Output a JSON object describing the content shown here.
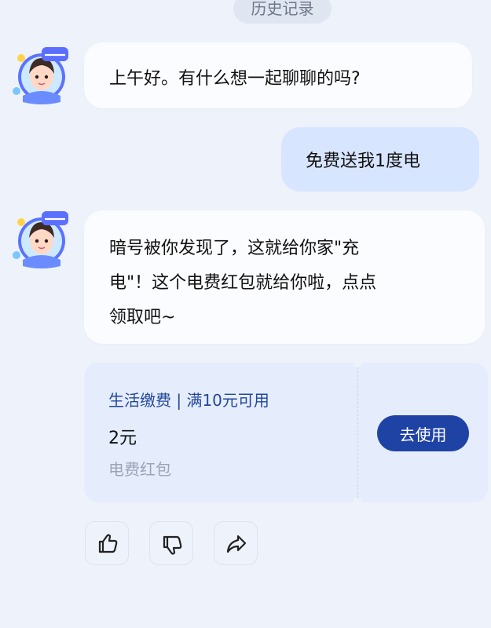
{
  "header": {
    "history_label": "历史记录"
  },
  "assistant": {
    "avatar_icon": "assistant-avatar-icon",
    "greeting": "上午好。有什么想一起聊聊的吗?",
    "reply_lines": [
      "暗号被你发现了，这就给你家\"充",
      "电\"！这个电费红包就给你啦，点点",
      "领取吧~"
    ]
  },
  "user": {
    "message": "免费送我1度电"
  },
  "coupon": {
    "title": "生活缴费 | 满10元可用",
    "amount": "2元",
    "name": "电费红包",
    "button_label": "去使用"
  },
  "actions": [
    {
      "icon": "thumbs-up-icon"
    },
    {
      "icon": "thumbs-down-icon"
    },
    {
      "icon": "share-icon"
    }
  ],
  "colors": {
    "background": "#eef3fb",
    "bubble_left": "#fbfcff",
    "bubble_right": "#d8e5ff",
    "coupon_bg": "#e5edfd",
    "coupon_title": "#23479b",
    "button_bg": "#1f43a5",
    "muted_text": "#9ba3b5"
  }
}
